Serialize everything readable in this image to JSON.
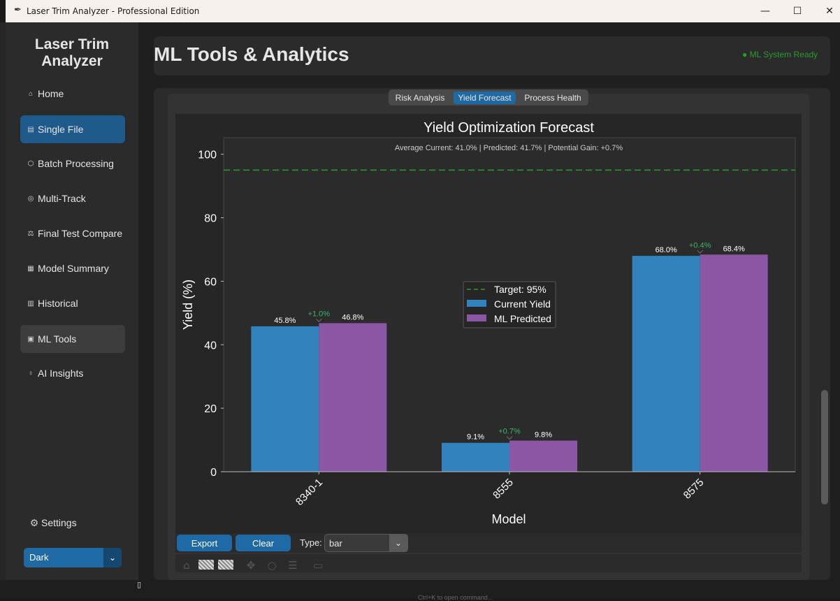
{
  "window": {
    "title": "Laser Trim Analyzer - Professional Edition",
    "minimize": "—",
    "maximize": "☐",
    "close": "✕"
  },
  "sidebar": {
    "brand": "Laser Trim Analyzer",
    "items": [
      {
        "label": "Home",
        "icon": "home-icon",
        "glyph": "⌂"
      },
      {
        "label": "Single File",
        "icon": "file-icon",
        "glyph": "▤"
      },
      {
        "label": "Batch Processing",
        "icon": "batch-icon",
        "glyph": "⬡"
      },
      {
        "label": "Multi-Track",
        "icon": "multi-track-icon",
        "glyph": "◎"
      },
      {
        "label": "Final Test Compare",
        "icon": "compare-icon",
        "glyph": "⚖"
      },
      {
        "label": "Model Summary",
        "icon": "summary-icon",
        "glyph": "▦"
      },
      {
        "label": "Historical",
        "icon": "history-icon",
        "glyph": "▥"
      },
      {
        "label": "ML Tools",
        "icon": "ml-icon",
        "glyph": "▣"
      },
      {
        "label": "AI Insights",
        "icon": "bulb-icon",
        "glyph": "♀"
      }
    ],
    "settings": {
      "label": "Settings",
      "icon": "gear-icon",
      "glyph": "⚙"
    },
    "theme": {
      "value": "Dark"
    }
  },
  "header": {
    "title": "ML Tools & Analytics",
    "status": "● ML System Ready",
    "status_color": "#2b9a2b"
  },
  "tabs": [
    {
      "label": "Risk Analysis",
      "active": false
    },
    {
      "label": "Yield Forecast",
      "active": true
    },
    {
      "label": "Process Health",
      "active": false
    }
  ],
  "chart_data": {
    "type": "bar",
    "title": "Yield Optimization Forecast",
    "subtitle": "Average Current: 41.0% | Predicted: 41.7% | Potential Gain: +0.7%",
    "xlabel": "Model",
    "ylabel": "Yield (%)",
    "categories": [
      "8340-1",
      "8555",
      "8575"
    ],
    "series": [
      {
        "name": "Current Yield",
        "values": [
          45.8,
          9.1,
          68.0
        ],
        "labels": [
          "45.8%",
          "9.1%",
          "68.0%"
        ],
        "color": "#3182bd"
      },
      {
        "name": "ML Predicted",
        "values": [
          46.8,
          9.8,
          68.4
        ],
        "labels": [
          "46.8%",
          "9.8%",
          "68.4%"
        ],
        "color": "#8b56a3"
      }
    ],
    "gains": [
      "+1.0%",
      "+0.7%",
      "+0.4%"
    ],
    "gain_color": "#3cb371",
    "target": {
      "name": "Target: 95%",
      "value": 95,
      "color": "#2a9d2a"
    },
    "ylim": [
      0,
      105
    ],
    "yticks": [
      0,
      20,
      40,
      60,
      80,
      100
    ],
    "grid": false,
    "legend": "center"
  },
  "controls": {
    "export": "Export",
    "clear": "Clear",
    "type_label": "Type:",
    "type_value": "bar",
    "chevron": "⌄"
  },
  "mpl_toolbar": [
    "home-icon",
    "back-icon",
    "forward-icon",
    "pan-icon",
    "zoom-icon",
    "configure-icon",
    "save-icon"
  ],
  "footer": {
    "hint": "Ctrl+K to open command..."
  }
}
